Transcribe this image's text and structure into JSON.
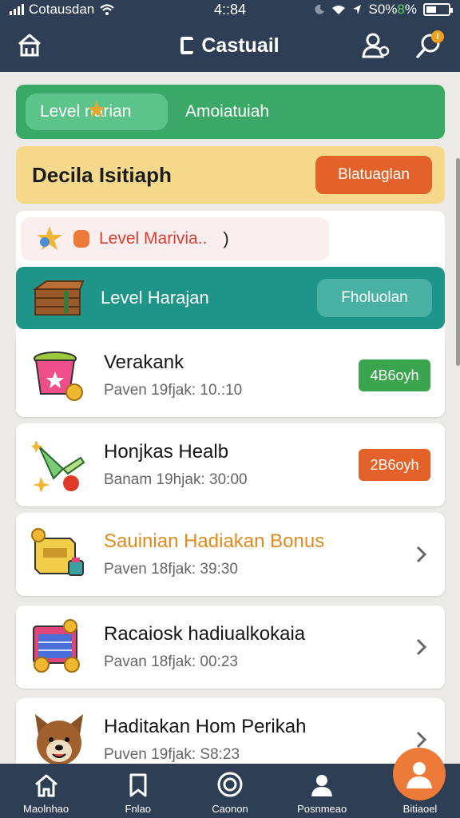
{
  "status_bar": {
    "carrier": "Cotausdan",
    "time": "4::84",
    "battery_text": "S0%",
    "battery_number": "8",
    "battery_suffix": "%"
  },
  "header": {
    "title": "Castuail",
    "notification_count": "!"
  },
  "level_tabs": {
    "active": "Level narian",
    "other": "Amoiatuiah"
  },
  "daily_banner": {
    "title": "Decila Isitiaph",
    "button": "Blatuaglan"
  },
  "info_pill": {
    "text": "Level Marivia..",
    "paren": ")"
  },
  "level_banner": {
    "title": "Level Harajan",
    "button": "Fholuolan"
  },
  "tasks": [
    {
      "title": "Verakank",
      "subtitle": "Paven 19fjak: 10.:10",
      "badge": "4B6oyh",
      "badge_color": "#3aa54e",
      "icon": "bucket-star-icon"
    },
    {
      "title": "Honjkas Healb",
      "subtitle": "Banam 19hjak: 30:00",
      "badge": "2B6oyh",
      "badge_color": "#e2622a",
      "icon": "party-horn-icon"
    },
    {
      "title": "Sauinian Hadiakan Bonus",
      "subtitle": "Paven 18fjak: 39:30",
      "icon": "bonus-box-icon",
      "title_color": "#e08a1e"
    },
    {
      "title": "Racaiosk hadiualkokaia",
      "subtitle": "Pavan 18fjak: 00:23",
      "icon": "calendar-coins-icon"
    },
    {
      "title": "Haditakan Hom Perikah",
      "subtitle": "Puven 19fjak: S8:23",
      "icon": "dog-avatar-icon"
    }
  ],
  "nav": [
    {
      "label": "Maolnhao",
      "icon": "home-icon"
    },
    {
      "label": "Fnlao",
      "icon": "bookmark-icon"
    },
    {
      "label": "Caonon",
      "icon": "target-icon"
    },
    {
      "label": "Posnmeao",
      "icon": "person-icon"
    },
    {
      "label": "Bitiaoel",
      "icon": "profile-icon"
    }
  ],
  "colors": {
    "header_bg": "#2d3e55",
    "green": "#3aa866",
    "yellow": "#f7d98c",
    "orange": "#e2622a",
    "teal": "#1f9488"
  }
}
